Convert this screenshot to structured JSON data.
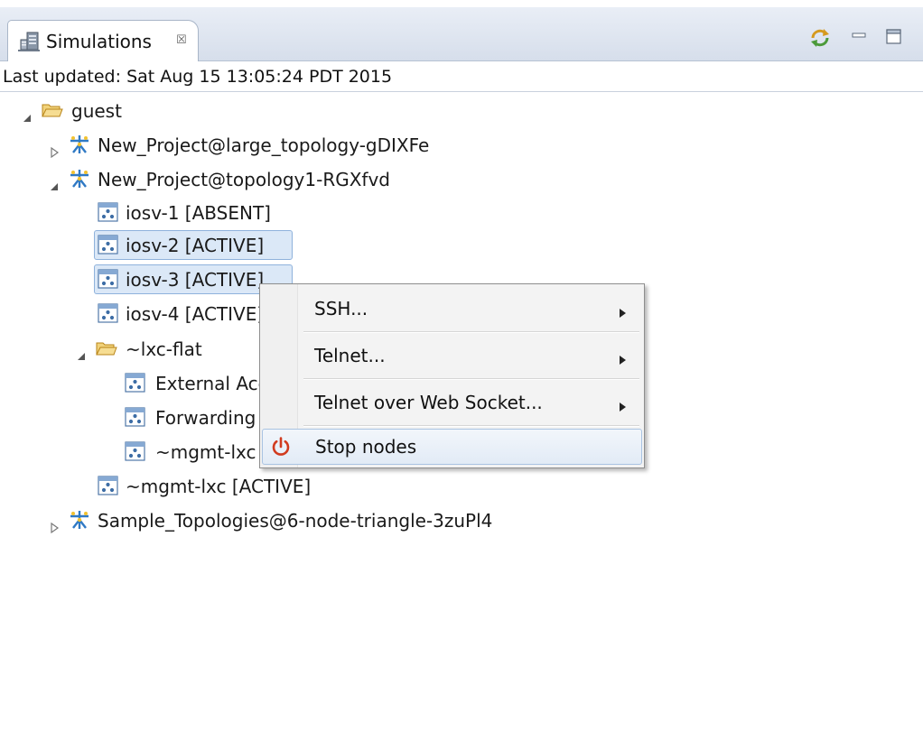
{
  "view": {
    "tab_title": "Simulations",
    "tab_close_glyph": "☒",
    "tab_icon": "server-rack-icon",
    "toolbar": {
      "sync_icon": "sync-icon",
      "minimize_icon": "minimize-icon",
      "maximize_icon": "maximize-icon"
    }
  },
  "status": {
    "last_updated": "Last updated: Sat Aug 15 13:05:24 PDT 2015"
  },
  "tree": {
    "root": {
      "label": "guest",
      "expanded": true,
      "icon": "folder-open-icon"
    },
    "projects": [
      {
        "label": "New_Project@large_topology-gDIXFe",
        "expanded": false,
        "icon": "topology-icon"
      },
      {
        "label": "New_Project@topology1-RGXfvd",
        "expanded": true,
        "icon": "topology-icon",
        "nodes": [
          {
            "label": "iosv-1  [ABSENT]",
            "selected": false,
            "icon": "node-icon"
          },
          {
            "label": "iosv-2  [ACTIVE]",
            "selected": true,
            "icon": "node-icon"
          },
          {
            "label": "iosv-3  [ACTIVE]",
            "selected": true,
            "icon": "node-icon"
          },
          {
            "label": "iosv-4  [ACTIVE]",
            "selected": false,
            "icon": "node-icon"
          }
        ],
        "folder": {
          "label": "~lxc-flat",
          "expanded": true,
          "icon": "folder-open-icon",
          "children": [
            {
              "label": "External Access",
              "icon": "node-icon"
            },
            {
              "label": "Forwarding",
              "icon": "node-icon"
            },
            {
              "label": "~mgmt-lxc",
              "icon": "node-icon"
            }
          ]
        },
        "tail_node": {
          "label": "~mgmt-lxc  [ACTIVE]",
          "icon": "node-icon"
        }
      },
      {
        "label": "Sample_Topologies@6-node-triangle-3zuPl4",
        "expanded": false,
        "icon": "topology-icon"
      }
    ]
  },
  "context_menu": {
    "items": [
      {
        "label": "SSH...",
        "submenu": true
      },
      {
        "label": "Telnet...",
        "submenu": true
      },
      {
        "label": "Telnet over Web Socket...",
        "submenu": true
      },
      {
        "label": "Stop nodes",
        "submenu": false,
        "icon": "power-icon",
        "highlighted": true
      }
    ]
  },
  "colors": {
    "selection": "#dbe8f7",
    "topology_icon": "#2f79c4",
    "folder_icon": "#e3b13a",
    "power_icon": "#d13b1f"
  }
}
